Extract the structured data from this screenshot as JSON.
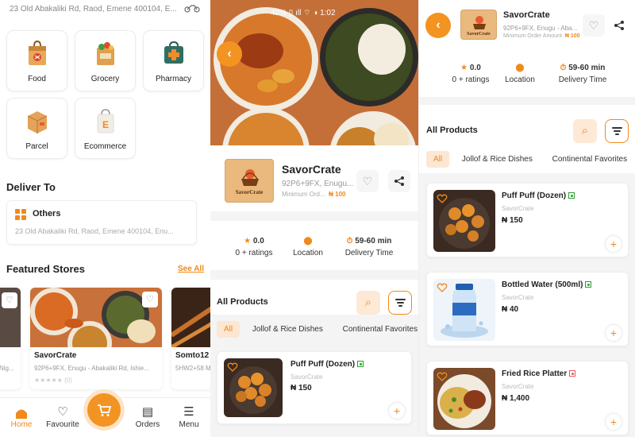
{
  "colors": {
    "accent": "#f08a1c",
    "accent_light": "#fde7d2",
    "veg": "#2ca02c",
    "nonveg": "#e05b5b"
  },
  "home": {
    "address": "23 Old Abakaliki Rd, Raod, Emene 400104, E...",
    "categories": [
      {
        "label": "Food",
        "icon": "food-bag-icon"
      },
      {
        "label": "Grocery",
        "icon": "grocery-bag-icon"
      },
      {
        "label": "Pharmacy",
        "icon": "pharmacy-kit-icon"
      },
      {
        "label": "Parcel",
        "icon": "parcel-box-icon"
      },
      {
        "label": "Ecommerce",
        "icon": "ecommerce-bag-icon"
      }
    ],
    "deliver_to": {
      "title": "Deliver To",
      "label": "Others",
      "address": "23 Old Abakaliki Rd, Raod, Emene 400104, Enu..."
    },
    "featured": {
      "title": "Featured Stores",
      "see_all": "See All",
      "left_partial": {
        "address": "Nig..."
      },
      "main": {
        "name": "SavorCrate",
        "address": "92P6+9FX, Enugu - Abakaliki Rd, Ishie...",
        "rating_count": "(0)"
      },
      "right_partial": {
        "name": "Somto12",
        "address": "5HW2+58 M..."
      }
    },
    "nav": [
      {
        "label": "Home",
        "icon": "home-icon"
      },
      {
        "label": "Favourite",
        "icon": "heart-icon"
      },
      {
        "label": "",
        "icon": "cart-icon"
      },
      {
        "label": "Orders",
        "icon": "orders-icon"
      },
      {
        "label": "Menu",
        "icon": "menu-icon"
      }
    ]
  },
  "store": {
    "status_bar": "42% ▯ ıll ⌔ ◑ 1:02",
    "name": "SavorCrate",
    "logo_text": "SavorCrate",
    "address_short": "92P6+9FX, Enugu...",
    "address_long": "92P6+9FX, Enugu - Aba...",
    "min_order_short": "Minimum Ord...",
    "min_order_long": "Minimum Order Amount",
    "min_amount": "₦ 100",
    "stats": [
      {
        "value": "0.0",
        "label": "0 + ratings",
        "icon": "star-icon"
      },
      {
        "value": "",
        "label": "Location",
        "icon": "location-pin-icon"
      },
      {
        "value": "59-60 min",
        "label": "Delivery Time",
        "icon": "timer-icon"
      }
    ],
    "products_title": "All Products",
    "tabs": [
      "All",
      "Jollof & Rice Dishes",
      "Continental Favorites"
    ],
    "products": [
      {
        "name": "Puff Puff (Dozen)",
        "store": "SavorCrate",
        "price": "₦ 150",
        "type": "veg"
      },
      {
        "name": "Bottled Water (500ml)",
        "store": "SavorCrate",
        "price": "₦ 40",
        "type": "veg"
      },
      {
        "name": "Fried Rice Platter",
        "store": "SavorCrate",
        "price": "₦ 1,400",
        "type": "nonveg"
      }
    ]
  }
}
